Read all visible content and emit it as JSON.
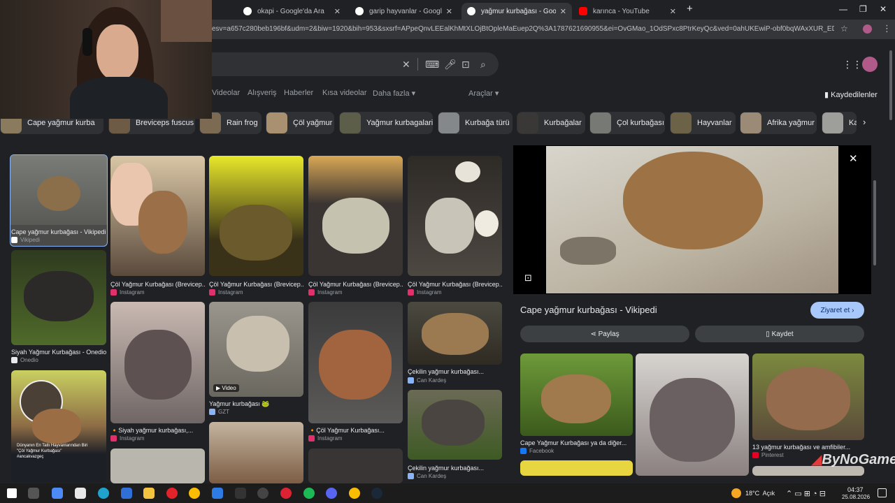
{
  "tabs": [
    {
      "title": "okapi - Google'da Ara",
      "active": false
    },
    {
      "title": "garip hayvanlar - Google'da Ara",
      "active": false
    },
    {
      "title": "yağmur kurbağası - Google'da",
      "active": true
    },
    {
      "title": "karınca - YouTube",
      "active": false
    }
  ],
  "url": "esv=a657c280beb196bf&udm=2&biw=1920&bih=953&sxsrf=APpeQnvLEEalKhMtXLOjBtOpleMaEuep2Q%3A1787621690955&ei=OvGMao_1OdSPxc8PtrKeyQc&ved=0ahUKEwiP-obf0bqWAxXUR_EDHTaZJ3kQ4dUD...",
  "filters": [
    "Videolar",
    "Alışveriş",
    "Haberler",
    "Kısa videolar",
    "Daha fazla",
    "Araçlar"
  ],
  "saved_label": "Kaydedilenler",
  "chips": [
    "Cape yağmur kurba",
    "Breviceps fuscus",
    "Rain frog",
    "Çöl yağmur",
    "Yağmur kurbagalari",
    "Kurbağa türü",
    "Kurbağalar",
    "Çol kurbağası",
    "Hayvanlar",
    "Afrika yağmur",
    "Ka"
  ],
  "results": {
    "col0": [
      {
        "caption": "Cape yağmur kurbağası - Vikipedi",
        "source": "Vikipedi"
      },
      {
        "caption": "Siyah Yağmur Kurbağası - Onedio",
        "source": "Onedio"
      },
      {
        "caption": "",
        "source": "",
        "overlay": "Dünyanın En Tatlı Hayvanlarından Biri\n\"Çöl Yağmur Kurbağası\"\n#ancakvazgeç"
      }
    ],
    "col1": [
      {
        "caption": "Çöl Yağmur Kurbağası (Brevicep...",
        "source": "Instagram"
      },
      {
        "caption": "🔸Siyah yağmur kurbağası,...",
        "source": "Instagram"
      }
    ],
    "col2": [
      {
        "caption": "Çöl Yağmur Kurbağası (Brevicep...",
        "source": "Instagram"
      },
      {
        "caption": "Yağmur kurbağası 🐸",
        "source": "GZT",
        "badge": "Video"
      }
    ],
    "col3": [
      {
        "caption": "Çöl Yağmur Kurbağası (Brevicep...",
        "source": "Instagram"
      },
      {
        "caption": "🔸Çöl Yağmur Kurbağası...",
        "source": "Instagram"
      }
    ],
    "col4": [
      {
        "caption": "Çöl Yağmur Kurbağası (Brevicep...",
        "source": "Instagram"
      },
      {
        "caption": "Çekilin yağmur kurbağası...",
        "source": "Can Kardeş"
      },
      {
        "caption": "Çekilin yağmur kurbağası...",
        "source": "Can Kardeş"
      }
    ]
  },
  "preview": {
    "title": "Cape yağmur kurbağası - Vikipedi",
    "visit_label": "Ziyaret et",
    "share_label": "Paylaş",
    "save_label": "Kaydet",
    "related": [
      {
        "caption": "Cape Yağmur Kurbağası ya da diğer...",
        "source": "Facebook"
      },
      {
        "caption": "",
        "source": ""
      },
      {
        "caption": "13 yağmur kurbağası ve amfibiler...",
        "source": "Pinterest"
      }
    ]
  },
  "watermark": "ByNoGame",
  "taskbar": {
    "weather": "18°C  Açık",
    "time": "04:37",
    "date": "25.08.2026"
  },
  "colors": {
    "accent": "#8ab4f8",
    "visit_btn": "#a8c7fa",
    "instagram": "#e1306c",
    "youtube": "#ff0000"
  }
}
